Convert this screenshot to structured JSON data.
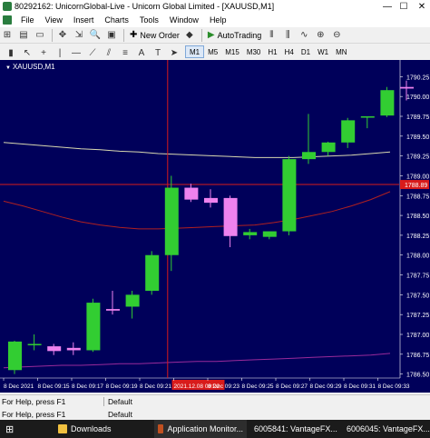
{
  "window": {
    "title": "80292162: UnicornGlobal-Live - Unicorn Global Limited - [XAUUSD,M1]",
    "minimize_glyph": "—",
    "maximize_glyph": "☐",
    "close_glyph": "✕"
  },
  "menu": {
    "items": [
      "File",
      "View",
      "Insert",
      "Charts",
      "Tools",
      "Window",
      "Help"
    ]
  },
  "toolbar": {
    "new_order_label": "New Order",
    "autotrading_label": "AutoTrading",
    "timeframes": [
      "M1",
      "M5",
      "M15",
      "M30",
      "H1",
      "H4",
      "D1",
      "W1",
      "MN"
    ],
    "active_timeframe": "M1"
  },
  "chart": {
    "symbol_label": "XAUUSD,M1",
    "current_price_label": "1788.89",
    "crosshair_time_label": "2021.12.08 09:22",
    "colors": {
      "background": "#00005a",
      "bull": "#32cd32",
      "bear": "#ee82ee",
      "axis_text": "#ffffff",
      "price_line": "#d81b1b",
      "ma_slow": "#d8d8b0",
      "ma_mid": "#b02020",
      "ma_fast": "#9a2a9a"
    }
  },
  "chart_data": {
    "type": "candlestick",
    "symbol": "XAUUSD",
    "timeframe": "M1",
    "ylim": [
      1786.45,
      1790.3
    ],
    "y_ticks": [
      "1790.25",
      "1790.00",
      "1789.75",
      "1789.50",
      "1789.25",
      "1789.00",
      "1788.75",
      "1788.50",
      "1788.25",
      "1788.00",
      "1787.75",
      "1787.50",
      "1787.25",
      "1787.00",
      "1786.75",
      "1786.50"
    ],
    "x_ticks": [
      "8 Dec 2021",
      "8 Dec 09:15",
      "8 Dec 09:17",
      "8 Dec 09:19",
      "8 Dec 09:21",
      "2021.12.08 09:22",
      "8 Dec 09:23",
      "8 Dec 09:25",
      "8 Dec 09:27",
      "8 Dec 09:29",
      "8 Dec 09:31",
      "8 Dec 09:33"
    ],
    "candles": [
      {
        "o": 1786.55,
        "h": 1786.92,
        "l": 1786.5,
        "c": 1786.91
      },
      {
        "o": 1786.88,
        "h": 1787.0,
        "l": 1786.8,
        "c": 1786.88
      },
      {
        "o": 1786.85,
        "h": 1786.88,
        "l": 1786.74,
        "c": 1786.79
      },
      {
        "o": 1786.83,
        "h": 1786.9,
        "l": 1786.74,
        "c": 1786.8
      },
      {
        "o": 1786.8,
        "h": 1787.45,
        "l": 1786.78,
        "c": 1787.4
      },
      {
        "o": 1787.32,
        "h": 1787.55,
        "l": 1787.25,
        "c": 1787.3
      },
      {
        "o": 1787.35,
        "h": 1787.55,
        "l": 1787.2,
        "c": 1787.5
      },
      {
        "o": 1787.55,
        "h": 1788.05,
        "l": 1787.5,
        "c": 1788.0
      },
      {
        "o": 1788.0,
        "h": 1789.0,
        "l": 1787.8,
        "c": 1788.85
      },
      {
        "o": 1788.85,
        "h": 1788.9,
        "l": 1788.67,
        "c": 1788.7
      },
      {
        "o": 1788.72,
        "h": 1788.83,
        "l": 1788.6,
        "c": 1788.66
      },
      {
        "o": 1788.72,
        "h": 1788.75,
        "l": 1788.1,
        "c": 1788.24
      },
      {
        "o": 1788.25,
        "h": 1788.33,
        "l": 1788.2,
        "c": 1788.29
      },
      {
        "o": 1788.23,
        "h": 1788.3,
        "l": 1788.2,
        "c": 1788.3
      },
      {
        "o": 1788.3,
        "h": 1789.25,
        "l": 1788.25,
        "c": 1789.21
      },
      {
        "o": 1789.21,
        "h": 1789.78,
        "l": 1789.15,
        "c": 1789.3
      },
      {
        "o": 1789.3,
        "h": 1789.43,
        "l": 1789.25,
        "c": 1789.42
      },
      {
        "o": 1789.42,
        "h": 1789.73,
        "l": 1789.35,
        "c": 1789.7
      },
      {
        "o": 1789.75,
        "h": 1789.75,
        "l": 1789.6,
        "c": 1789.75
      },
      {
        "o": 1789.76,
        "h": 1790.12,
        "l": 1789.74,
        "c": 1790.08
      },
      {
        "o": 1790.12,
        "h": 1790.2,
        "l": 1789.95,
        "c": 1790.1
      }
    ],
    "moving_averages": [
      {
        "color": "#d8d8b0",
        "values": [
          1789.42,
          1789.4,
          1789.38,
          1789.36,
          1789.34,
          1789.33,
          1789.31,
          1789.3,
          1789.28,
          1789.27,
          1789.26,
          1789.25,
          1789.24,
          1789.23,
          1789.23,
          1789.23,
          1789.24,
          1789.25,
          1789.26,
          1789.28,
          1789.3
        ]
      },
      {
        "color": "#b02020",
        "values": [
          1788.68,
          1788.62,
          1788.55,
          1788.48,
          1788.42,
          1788.38,
          1788.35,
          1788.33,
          1788.33,
          1788.34,
          1788.35,
          1788.36,
          1788.37,
          1788.38,
          1788.41,
          1788.45,
          1788.5,
          1788.55,
          1788.62,
          1788.7,
          1788.8
        ]
      },
      {
        "color": "#9a2a9a",
        "values": [
          1786.58,
          1786.59,
          1786.6,
          1786.61,
          1786.61,
          1786.62,
          1786.63,
          1786.63,
          1786.64,
          1786.65,
          1786.66,
          1786.66,
          1786.67,
          1786.68,
          1786.69,
          1786.7,
          1786.71,
          1786.72,
          1786.73,
          1786.74,
          1786.76
        ]
      }
    ],
    "price_line": 1788.89,
    "crosshair_candle_index": 8
  },
  "status": {
    "help_text": "For Help, press F1",
    "profile": "Default",
    "help_text_2": "For Help, press F1",
    "profile_2": "Default"
  },
  "taskbar": {
    "items": [
      {
        "label": "Downloads",
        "color": "#f0c040"
      },
      {
        "label": "Application Monitor...",
        "color": "#c05020"
      },
      {
        "label": "6005841: VantageFX...",
        "color": "#d02020"
      },
      {
        "label": "6006045: VantageFX...",
        "color": "#d02020"
      }
    ]
  }
}
